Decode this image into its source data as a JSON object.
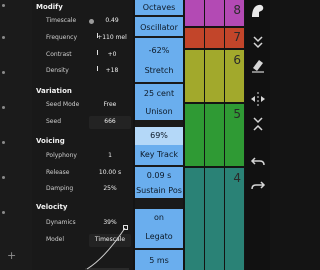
{
  "modify": {
    "header": "Modify",
    "rows": [
      {
        "label": "Timescale",
        "value": "0.49"
      },
      {
        "label": "Frequency",
        "value": "+110 mel"
      },
      {
        "label": "Contrast",
        "value": "+0"
      },
      {
        "label": "Density",
        "value": "+18"
      }
    ]
  },
  "variation": {
    "header": "Variation",
    "rows": [
      {
        "label": "Seed Mode",
        "value": "Free"
      },
      {
        "label": "Seed",
        "value": "666"
      }
    ]
  },
  "voicing": {
    "header": "Voicing",
    "rows": [
      {
        "label": "Polyphony",
        "value": "1"
      },
      {
        "label": "Release",
        "value": "10.00 s"
      },
      {
        "label": "Damping",
        "value": "25%"
      }
    ]
  },
  "velocity": {
    "header": "Velocity",
    "rows": [
      {
        "label": "Dynamics",
        "value": "39%"
      },
      {
        "label": "Model",
        "value": "Timescale"
      }
    ]
  },
  "params": [
    {
      "label": "Octaves",
      "value": ""
    },
    {
      "label": "Oscillator",
      "value": ""
    },
    {
      "label": "Stretch",
      "value": "-62%"
    },
    {
      "label": "Unison",
      "value": "25 cent"
    },
    {
      "label": "Key Track",
      "value": "69%"
    },
    {
      "label": "Sustain Pos",
      "value": "0.09 s"
    },
    {
      "label": "Legato",
      "value": "on"
    },
    {
      "label": "",
      "value": "5 ms"
    }
  ],
  "pads": {
    "numbers": [
      "8",
      "7",
      "6",
      "5",
      "4"
    ],
    "colors": {
      "magenta": "#b34ab4",
      "red": "#c2452a",
      "olive": "#a2a92c",
      "green": "#2f9a34",
      "teal": "#2a8276"
    }
  },
  "toolbar": {
    "icons": [
      "app-logo-icon",
      "collapse-icon",
      "filter-icon",
      "erase-icon",
      "split-icon",
      "compress-icon",
      "undo-icon",
      "redo-icon"
    ]
  }
}
